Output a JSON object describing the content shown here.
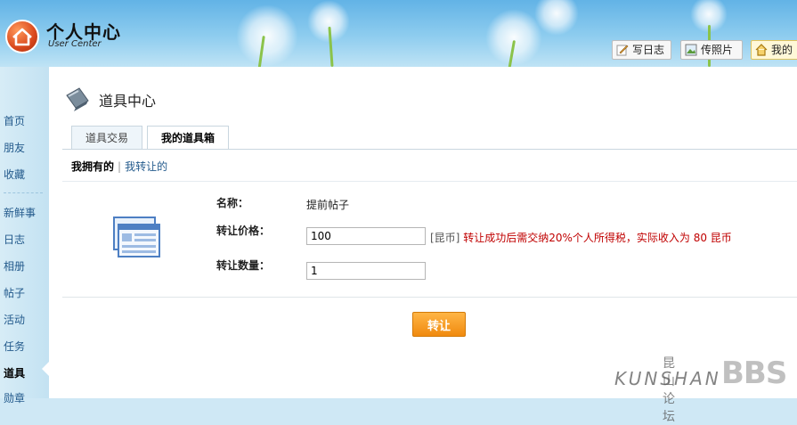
{
  "header": {
    "logo_title": "个人中心",
    "logo_subtitle": "User Center",
    "buttons": [
      {
        "label": "写日志",
        "icon": "pencil-icon"
      },
      {
        "label": "传照片",
        "icon": "photo-icon"
      },
      {
        "label": "我的",
        "icon": "home-icon"
      }
    ]
  },
  "sidebar": {
    "items": [
      {
        "label": "首页"
      },
      {
        "label": "朋友"
      },
      {
        "label": "收藏"
      },
      {
        "label": "新鲜事"
      },
      {
        "label": "日志"
      },
      {
        "label": "相册"
      },
      {
        "label": "帖子"
      },
      {
        "label": "活动"
      },
      {
        "label": "任务"
      },
      {
        "label": "道具"
      },
      {
        "label": "勋章"
      }
    ],
    "current": "道具"
  },
  "main": {
    "title": "道具中心",
    "tabs": [
      {
        "label": "道具交易"
      },
      {
        "label": "我的道具箱"
      }
    ],
    "active_tab": "我的道具箱",
    "subnav": {
      "current": "我拥有的",
      "separator": "|",
      "link": "我转让的"
    },
    "form": {
      "name_label": "名称：",
      "name_value": "提前帖子",
      "price_label": "转让价格：",
      "price_value": "100",
      "price_unit": "[昆币]",
      "price_note": "转让成功后需交纳20%个人所得税，实际收入为  80 昆币",
      "qty_label": "转让数量：",
      "qty_value": "1",
      "submit_label": "转让"
    }
  },
  "watermark": {
    "cn": "昆山论坛",
    "main": "KUNSHAN",
    "bbs": "BBS"
  },
  "colors": {
    "link": "#235a8c",
    "warning": "#c00000",
    "button": "#f08a0f",
    "sky": "#62b3e6"
  }
}
